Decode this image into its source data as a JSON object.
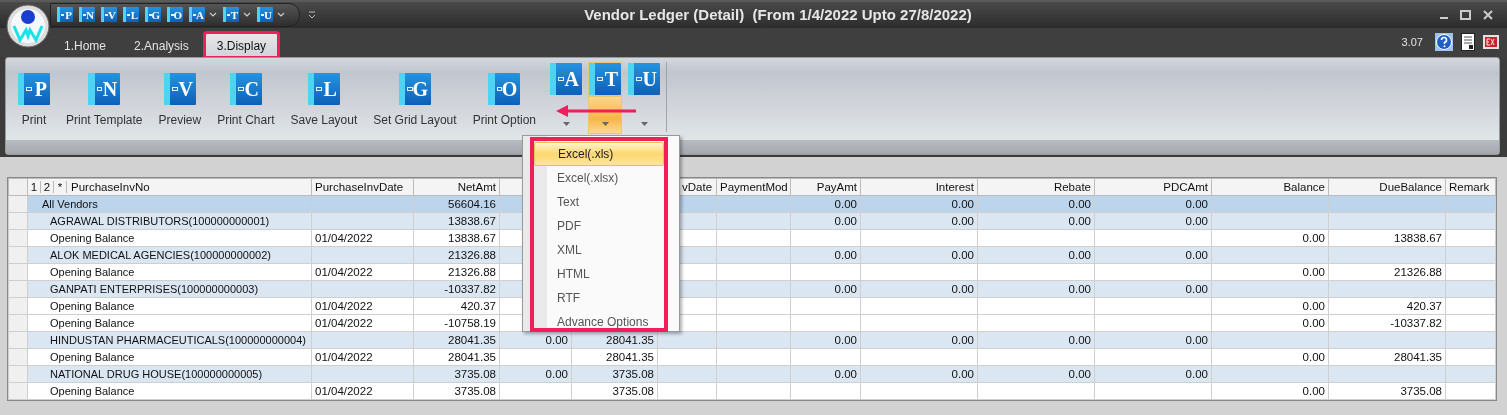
{
  "window": {
    "title": "Vendor Ledger (Detail)  (From 1/4/2022 Upto 27/8/2022)"
  },
  "quick_access": [
    {
      "letter": "P",
      "dropdown": false
    },
    {
      "letter": "N",
      "dropdown": false
    },
    {
      "letter": "V",
      "dropdown": false
    },
    {
      "letter": "L",
      "dropdown": false
    },
    {
      "letter": "G",
      "dropdown": false
    },
    {
      "letter": "O",
      "dropdown": false
    },
    {
      "letter": "A",
      "dropdown": true
    },
    {
      "letter": "T",
      "dropdown": true
    },
    {
      "letter": "U",
      "dropdown": true
    }
  ],
  "tabs": [
    {
      "label": "1.Home",
      "selected": false,
      "highlighted": false
    },
    {
      "label": "2.Analysis",
      "selected": false,
      "highlighted": false
    },
    {
      "label": "3.Display",
      "selected": true,
      "highlighted": true
    }
  ],
  "version": "3.07",
  "ribbon": [
    {
      "kind": "large",
      "letter": "P",
      "label": "Print"
    },
    {
      "kind": "large",
      "letter": "N",
      "label": "Print Template"
    },
    {
      "kind": "large",
      "letter": "V",
      "label": "Preview"
    },
    {
      "kind": "large",
      "letter": "C",
      "label": "Print Chart"
    },
    {
      "kind": "large",
      "letter": "L",
      "label": "Save Layout"
    },
    {
      "kind": "large",
      "letter": "G",
      "label": "Set Grid Layout"
    },
    {
      "kind": "large",
      "letter": "O",
      "label": "Print Option"
    },
    {
      "kind": "split",
      "letter": "A",
      "expanded": false
    },
    {
      "kind": "split",
      "letter": "T",
      "expanded": true
    },
    {
      "kind": "split",
      "letter": "U",
      "expanded": false
    }
  ],
  "annotation_arrow": true,
  "export_menu": {
    "highlighted": true,
    "items": [
      {
        "label": "Excel(.xls)",
        "selected": true
      },
      {
        "label": "Excel(.xlsx)",
        "selected": false
      },
      {
        "label": "Text",
        "selected": false
      },
      {
        "label": "PDF",
        "selected": false
      },
      {
        "label": "XML",
        "selected": false
      },
      {
        "label": "HTML",
        "selected": false
      },
      {
        "label": "RTF",
        "selected": false
      },
      {
        "label": "Advance Options",
        "selected": false
      }
    ]
  },
  "grid": {
    "group_levels": [
      "1",
      "2",
      "*"
    ],
    "columns": [
      {
        "label": "PurchaseInvNo"
      },
      {
        "label": "PurchaseInvDate"
      },
      {
        "label": "NetAmt"
      },
      {},
      {},
      {
        "label": "vDate"
      },
      {
        "label": "PaymentMod"
      },
      {
        "label": "PayAmt"
      },
      {
        "label": "Interest"
      },
      {
        "label": "Rebate"
      },
      {
        "label": "PDCAmt"
      },
      {
        "label": "Balance"
      },
      {
        "label": "DueBalance"
      },
      {
        "label": "Remark"
      }
    ],
    "rows": [
      {
        "kind": "total",
        "cells": [
          "All Vendors",
          null,
          "56604.16",
          null,
          null,
          null,
          null,
          "0.00",
          "0.00",
          "0.00",
          "0.00",
          null,
          null,
          null
        ]
      },
      {
        "kind": "group",
        "cells": [
          "AGRAWAL DISTRIBUTORS(100000000001)",
          null,
          "13838.67",
          null,
          null,
          null,
          null,
          "0.00",
          "0.00",
          "0.00",
          "0.00",
          null,
          null,
          null
        ]
      },
      {
        "kind": "detail",
        "cells": [
          "Opening Balance",
          "01/04/2022",
          "13838.67",
          null,
          null,
          null,
          null,
          null,
          null,
          null,
          null,
          "0.00",
          "13838.67",
          null
        ]
      },
      {
        "kind": "group",
        "cells": [
          "ALOK MEDICAL AGENCIES(100000000002)",
          null,
          "21326.88",
          null,
          null,
          null,
          null,
          "0.00",
          "0.00",
          "0.00",
          "0.00",
          null,
          null,
          null
        ]
      },
      {
        "kind": "detail",
        "cells": [
          "Opening Balance",
          "01/04/2022",
          "21326.88",
          null,
          null,
          null,
          null,
          null,
          null,
          null,
          null,
          "0.00",
          "21326.88",
          null
        ]
      },
      {
        "kind": "group",
        "cells": [
          "GANPATI ENTERPRISES(100000000003)",
          null,
          "-10337.82",
          null,
          null,
          null,
          null,
          "0.00",
          "0.00",
          "0.00",
          "0.00",
          null,
          null,
          null
        ]
      },
      {
        "kind": "detail",
        "cells": [
          "Opening Balance",
          "01/04/2022",
          "420.37",
          null,
          null,
          null,
          null,
          null,
          null,
          null,
          null,
          "0.00",
          "420.37",
          null
        ]
      },
      {
        "kind": "detail",
        "cells": [
          "Opening Balance",
          "01/04/2022",
          "-10758.19",
          null,
          null,
          null,
          null,
          null,
          null,
          null,
          null,
          "0.00",
          "-10337.82",
          null
        ]
      },
      {
        "kind": "group",
        "cells": [
          "HINDUSTAN PHARMACEUTICALS(100000000004)",
          null,
          "28041.35",
          "0.00",
          "28041.35",
          null,
          null,
          "0.00",
          "0.00",
          "0.00",
          "0.00",
          null,
          null,
          null
        ]
      },
      {
        "kind": "detail",
        "cells": [
          "Opening Balance",
          "01/04/2022",
          "28041.35",
          null,
          "28041.35",
          null,
          null,
          null,
          null,
          null,
          null,
          "0.00",
          "28041.35",
          null
        ]
      },
      {
        "kind": "group",
        "cells": [
          "NATIONAL DRUG HOUSE(100000000005)",
          null,
          "3735.08",
          "0.00",
          "3735.08",
          null,
          null,
          "0.00",
          "0.00",
          "0.00",
          "0.00",
          null,
          null,
          null
        ]
      },
      {
        "kind": "detail",
        "cells": [
          "Opening Balance",
          "01/04/2022",
          "3735.08",
          null,
          "3735.08",
          null,
          null,
          null,
          null,
          null,
          null,
          "0.00",
          "3735.08",
          null
        ]
      }
    ]
  }
}
